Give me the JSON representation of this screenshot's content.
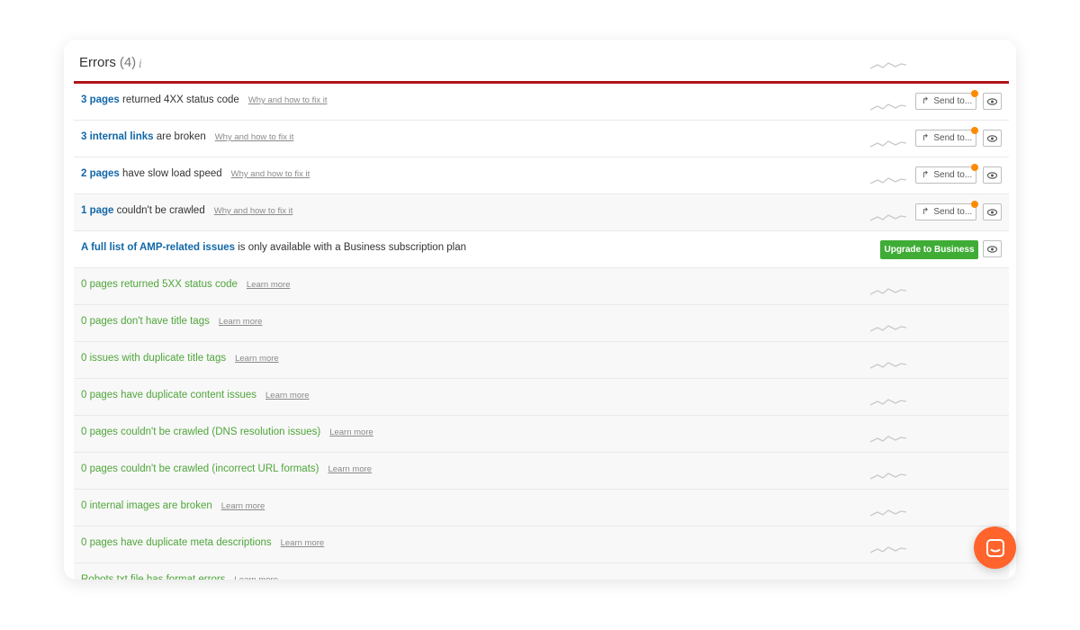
{
  "header": {
    "title": "Errors",
    "count": "(4)",
    "info_icon": "info-icon"
  },
  "rows": [
    {
      "type": "issue",
      "link": "3 pages",
      "text": "returned 4XX status code",
      "help": "Why and how to fix it",
      "send_label": "Send to..."
    },
    {
      "type": "issue",
      "link": "3 internal links",
      "text": "are broken",
      "help": "Why and how to fix it",
      "send_label": "Send to..."
    },
    {
      "type": "issue",
      "link": "2 pages",
      "text": "have slow load speed",
      "help": "Why and how to fix it",
      "send_label": "Send to..."
    },
    {
      "type": "issue",
      "link": "1 page",
      "text": "couldn't be crawled",
      "help": "Why and how to fix it",
      "send_label": "Send to..."
    },
    {
      "type": "upgrade",
      "link": "A full list of AMP-related issues",
      "text": "is only available with a Business subscription plan",
      "button": "Upgrade to Business"
    },
    {
      "type": "zero",
      "text": "0 pages returned 5XX status code",
      "help": "Learn more"
    },
    {
      "type": "zero",
      "text": "0 pages don't have title tags",
      "help": "Learn more"
    },
    {
      "type": "zero",
      "text": "0 issues with duplicate title tags",
      "help": "Learn more"
    },
    {
      "type": "zero",
      "text": "0 pages have duplicate content issues",
      "help": "Learn more"
    },
    {
      "type": "zero",
      "text": "0 pages couldn't be crawled (DNS resolution issues)",
      "help": "Learn more"
    },
    {
      "type": "zero",
      "text": "0 pages couldn't be crawled (incorrect URL formats)",
      "help": "Learn more"
    },
    {
      "type": "zero",
      "text": "0 internal images are broken",
      "help": "Learn more"
    },
    {
      "type": "zero",
      "text": "0 pages have duplicate meta descriptions",
      "help": "Learn more"
    },
    {
      "type": "zero",
      "text": "Robots.txt file has format errors",
      "help": "Learn more"
    }
  ],
  "colors": {
    "accent_red": "#b0141a",
    "link_blue": "#1167a8",
    "ok_green": "#4fa53a",
    "upgrade_green": "#3fac36",
    "notify_orange": "#ff8a00",
    "chat_orange": "#ff642d"
  }
}
